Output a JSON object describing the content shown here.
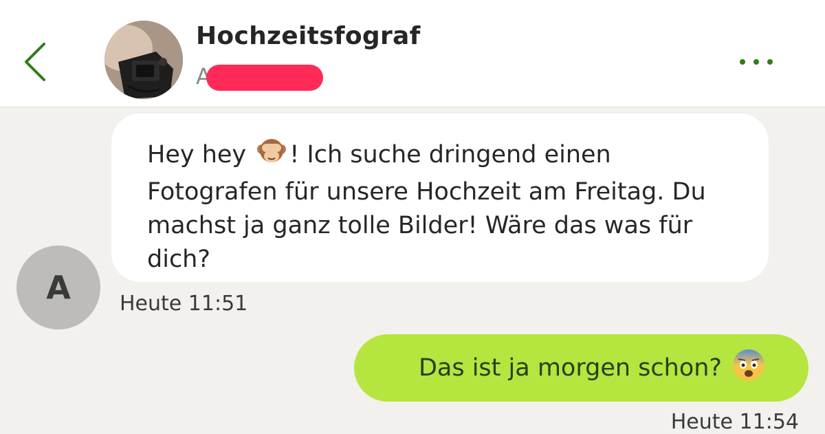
{
  "header": {
    "title": "Hochzeitsfograf",
    "subtitle_visible": "A",
    "back_icon": "chevron-left-icon",
    "more_icon": "more-dots-icon",
    "accent_color": "#2e7d18",
    "redaction_color": "#ff2a57"
  },
  "messages": [
    {
      "direction": "incoming",
      "sender_initial": "A",
      "text_before_emoji": "Hey hey ",
      "emoji": "see-no-evil-monkey-emoji",
      "text_after_emoji": "! Ich suche dringend einen Fotografen für unsere Hochzeit am Freitag. Du machst ja ganz tolle Bilder! Wäre das was für dich?",
      "timestamp": "Heute 11:51",
      "bubble_color": "#ffffff"
    },
    {
      "direction": "outgoing",
      "text": "Das ist ja morgen schon?",
      "emoji": "anxious-face-emoji",
      "timestamp": "Heute 11:54",
      "bubble_color": "#b5e53f"
    }
  ]
}
